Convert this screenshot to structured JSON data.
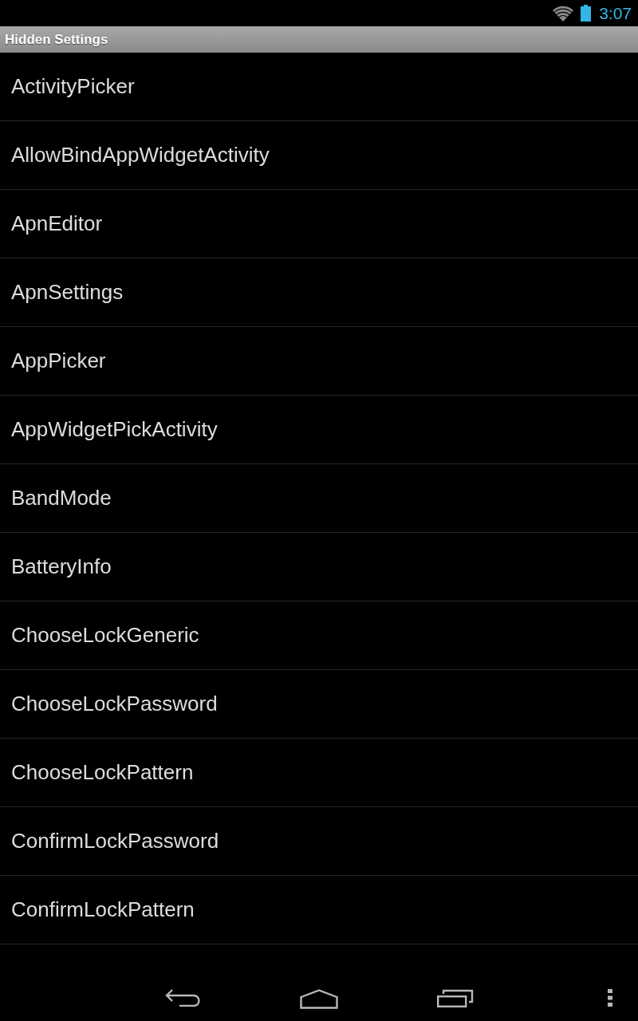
{
  "status_bar": {
    "time": "3:07"
  },
  "title_bar": {
    "title": "Hidden Settings"
  },
  "items": [
    {
      "label": "ActivityPicker"
    },
    {
      "label": "AllowBindAppWidgetActivity"
    },
    {
      "label": "ApnEditor"
    },
    {
      "label": "ApnSettings"
    },
    {
      "label": "AppPicker"
    },
    {
      "label": "AppWidgetPickActivity"
    },
    {
      "label": "BandMode"
    },
    {
      "label": "BatteryInfo"
    },
    {
      "label": "ChooseLockGeneric"
    },
    {
      "label": "ChooseLockPassword"
    },
    {
      "label": "ChooseLockPattern"
    },
    {
      "label": "ConfirmLockPassword"
    },
    {
      "label": "ConfirmLockPattern"
    }
  ]
}
